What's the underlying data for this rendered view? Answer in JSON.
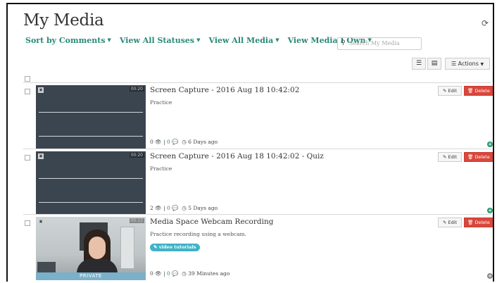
{
  "page": {
    "title": "My Media"
  },
  "filters": [
    {
      "label": "Sort by Comments"
    },
    {
      "label": "View All Statuses"
    },
    {
      "label": "View All Media"
    },
    {
      "label": "View Media I Own"
    }
  ],
  "search": {
    "placeholder": "Search My Media"
  },
  "toolbar": {
    "actions_label": "Actions"
  },
  "media": [
    {
      "title": "Screen Capture - 2016 Aug 18 10:42:02",
      "description": "Practice",
      "duration": "00:20",
      "views": "0",
      "comments": "0",
      "age": "6 Days ago",
      "tag": "",
      "privacy": ""
    },
    {
      "title": "Screen Capture - 2016 Aug 18 10:42:02 - Quiz",
      "description": "Practice",
      "duration": "00:20",
      "views": "2",
      "comments": "0",
      "age": "5 Days ago",
      "tag": "",
      "privacy": ""
    },
    {
      "title": "Media Space Webcam Recording",
      "description": "Practice recording using a webcam.",
      "duration": "00:13",
      "views": "0",
      "comments": "0",
      "age": "39 Minutes ago",
      "tag": "video tutorials",
      "privacy": "PRIVATE"
    }
  ],
  "row_actions": {
    "edit_label": "Edit",
    "delete_label": "Delete"
  },
  "colors": {
    "accent": "#2a8a78",
    "delete": "#d9473c",
    "chip": "#3eb3c8",
    "plus": "#1e9b6b"
  },
  "icons": [
    "refresh-icon",
    "search-icon",
    "list-view-icon",
    "detail-view-icon",
    "actions-icon",
    "pencil-icon",
    "trash-icon",
    "eye-icon",
    "comment-icon",
    "clock-icon",
    "plus-circle-icon"
  ]
}
